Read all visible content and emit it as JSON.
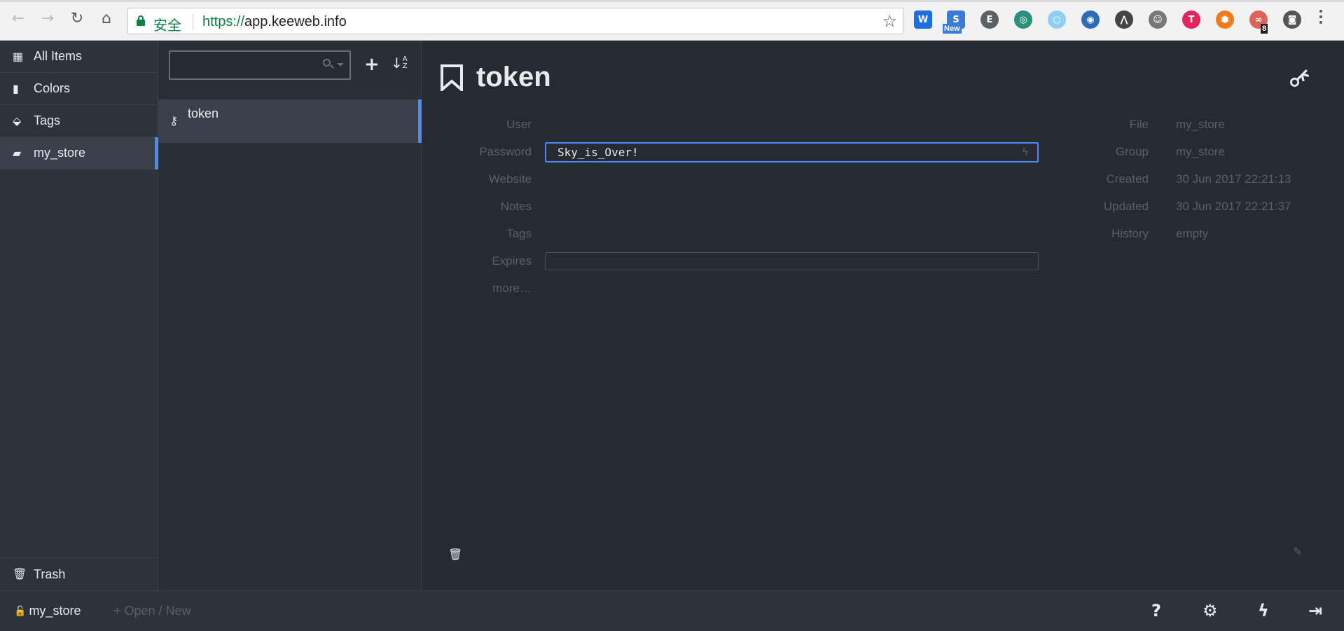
{
  "browser": {
    "secure_label": "安全",
    "url_scheme": "https://",
    "url_host": "app.keeweb.info",
    "ext_new_badge": "New",
    "ext_count_badge": "8"
  },
  "menu": {
    "items": [
      {
        "label": "All Items",
        "icon": "grid-icon"
      },
      {
        "label": "Colors",
        "icon": "bookmark-icon"
      },
      {
        "label": "Tags",
        "icon": "tags-icon"
      },
      {
        "label": "my_store",
        "icon": "folder-open-icon"
      }
    ],
    "trash_label": "Trash"
  },
  "list": {
    "search_placeholder": "",
    "entries": [
      {
        "title": "token"
      }
    ]
  },
  "details": {
    "title": "token",
    "labels": {
      "user": "User",
      "password": "Password",
      "website": "Website",
      "notes": "Notes",
      "tags": "Tags",
      "expires": "Expires",
      "more": "more…"
    },
    "password_value": "Sky_is_Over!",
    "meta": {
      "file_label": "File",
      "file_value": "my_store",
      "group_label": "Group",
      "group_value": "my_store",
      "created_label": "Created",
      "created_value": "30 Jun 2017 22:21:13",
      "updated_label": "Updated",
      "updated_value": "30 Jun 2017 22:21:37",
      "history_label": "History",
      "history_value": "empty"
    }
  },
  "footer": {
    "file_name": "my_store",
    "open_new": "Open / New"
  },
  "colors": {
    "accent": "#4d8af5",
    "app_bg": "#262a32",
    "muted_text": "#5b5f67",
    "secure_green": "#0b8043"
  }
}
